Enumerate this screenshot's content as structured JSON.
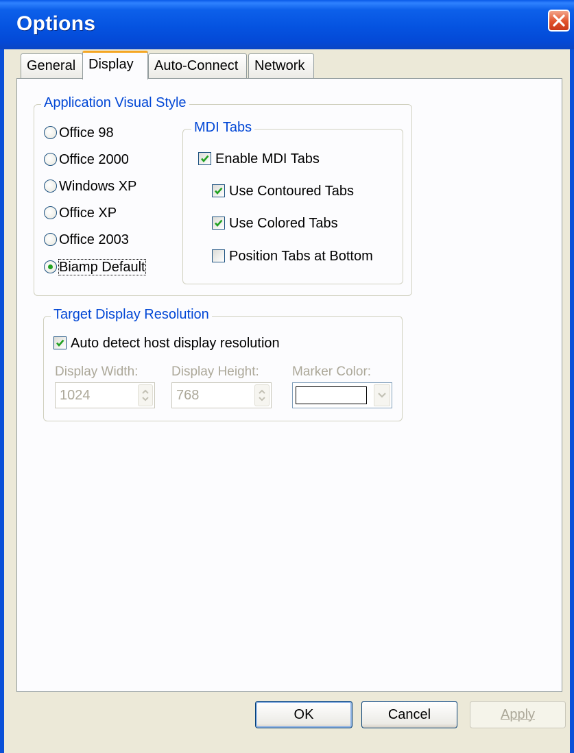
{
  "window": {
    "title": "Options"
  },
  "tabs": [
    {
      "label": "General"
    },
    {
      "label": "Display"
    },
    {
      "label": "Auto-Connect"
    },
    {
      "label": "Network"
    }
  ],
  "active_tab": "Display",
  "visual_style": {
    "legend": "Application Visual Style",
    "options": [
      {
        "label": "Office 98",
        "selected": false
      },
      {
        "label": "Office 2000",
        "selected": false
      },
      {
        "label": "Windows XP",
        "selected": false
      },
      {
        "label": "Office XP",
        "selected": false
      },
      {
        "label": "Office 2003",
        "selected": false
      },
      {
        "label": "Biamp Default",
        "selected": true
      }
    ]
  },
  "mdi_tabs": {
    "legend": "MDI Tabs",
    "enable": {
      "label": "Enable MDI Tabs",
      "checked": true
    },
    "contoured": {
      "label": "Use Contoured Tabs",
      "checked": true
    },
    "colored": {
      "label": "Use Colored Tabs",
      "checked": true
    },
    "bottom": {
      "label": "Position Tabs at Bottom",
      "checked": false
    }
  },
  "resolution": {
    "legend": "Target Display Resolution",
    "auto_detect": {
      "label": "Auto detect host display resolution",
      "checked": true
    },
    "width": {
      "label": "Display Width:",
      "value": "1024"
    },
    "height": {
      "label": "Display Height:",
      "value": "768"
    },
    "marker": {
      "label": "Marker Color:",
      "color": "#ffffff"
    }
  },
  "buttons": {
    "ok": "OK",
    "cancel": "Cancel",
    "apply": "Apply"
  },
  "colors": {
    "title_bar": "#0553e0",
    "legend_text": "#0046d5",
    "active_tab_accent": "#f5a623",
    "dialog_bg": "#ece9d8"
  }
}
